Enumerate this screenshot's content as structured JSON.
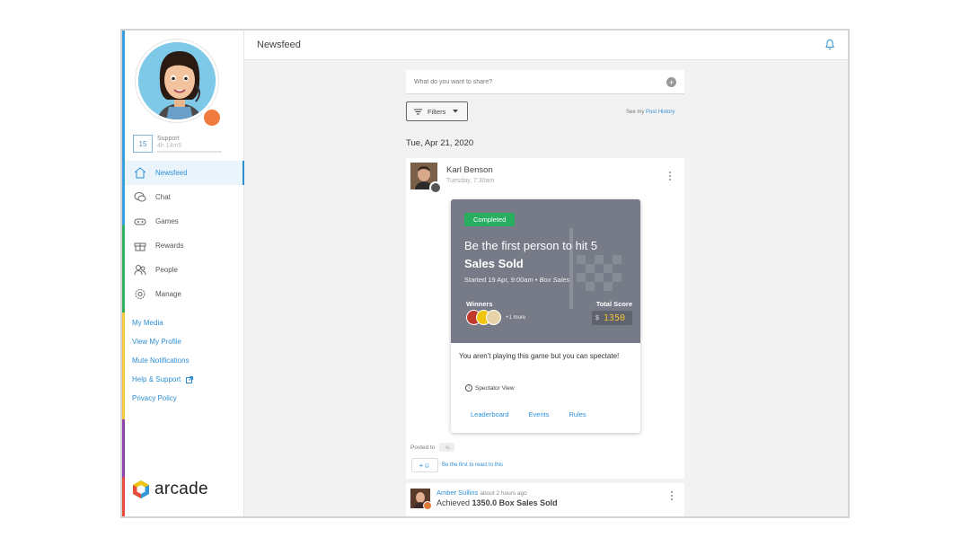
{
  "header": {
    "title": "Newsfeed"
  },
  "profile": {
    "level": "15",
    "support_label": "Support",
    "support_points": "4h 14m5"
  },
  "nav": [
    {
      "label": "Newsfeed",
      "icon": "home-icon",
      "active": true
    },
    {
      "label": "Chat",
      "icon": "chat-icon",
      "active": false
    },
    {
      "label": "Games",
      "icon": "gamepad-icon",
      "active": false
    },
    {
      "label": "Rewards",
      "icon": "gift-icon",
      "active": false
    },
    {
      "label": "People",
      "icon": "people-icon",
      "active": false
    },
    {
      "label": "Manage",
      "icon": "gear-icon",
      "active": false
    }
  ],
  "links": {
    "my_media": "My Media",
    "view_profile": "View My Profile",
    "mute": "Mute Notifications",
    "help": "Help & Support",
    "privacy": "Privacy Policy"
  },
  "logo": {
    "text": "arcade"
  },
  "composer": {
    "placeholder": "What do you want to share?"
  },
  "filters": {
    "label": "Filters"
  },
  "post_history": {
    "prefix": "See my",
    "link": "Post History"
  },
  "date_heading": "Tue, Apr 21, 2020",
  "post": {
    "author": "Karl Benson",
    "time": "Tuesday, 7:30am",
    "game": {
      "status": "Completed",
      "title_prefix": "Be the first person to hit 5",
      "title_bold": "Sales Sold",
      "started": "Started 19 Apr, 9:00am •",
      "category": "Box Sales",
      "winners_label": "Winners",
      "more_label": "+1 more",
      "total_label": "Total Score",
      "currency": "$",
      "score": "1350"
    },
    "spectate_text": "You aren't playing this game but you can spectate!",
    "spectator_view": "Spectator View",
    "tabs": [
      "Leaderboard",
      "Events",
      "Rules"
    ],
    "posted_to_label": "Posted to",
    "posted_to_chip": "ﾒﾑ",
    "react_label": "+☺",
    "react_hint": "Be the first to react to this"
  },
  "activity": {
    "author": "Amber Sullins",
    "time": "about 2 hours ago",
    "prefix": "Achieved",
    "achievement": "1350.0 Box Sales Sold"
  },
  "colors": {
    "accent": "#2f8fd4",
    "completed": "#27ae60",
    "game_bg": "#767b87",
    "score": "#f5c23a"
  }
}
